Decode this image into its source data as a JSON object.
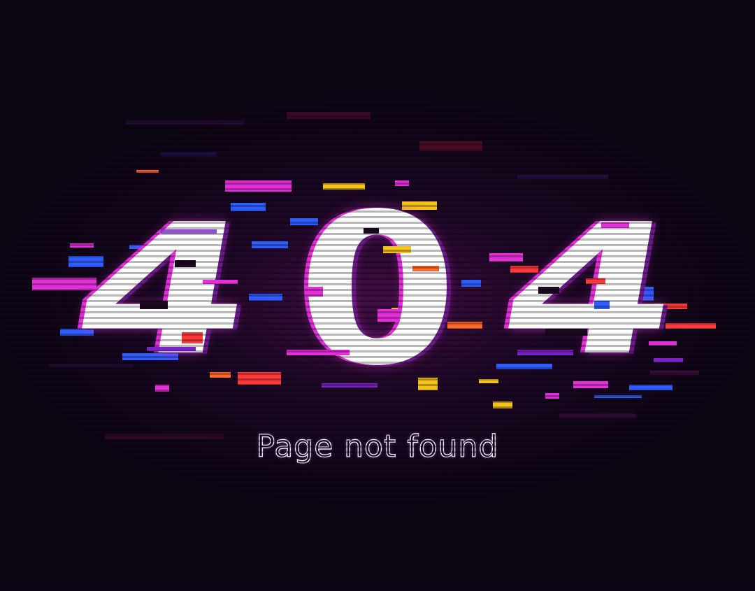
{
  "error": {
    "code_digits": [
      "4",
      "0",
      "4"
    ],
    "message": "Page not found"
  },
  "colors": {
    "background": "#0c0514",
    "glow": "#6e146e",
    "digit_fill": "#ffffff",
    "digit_outline": "#e22fd8",
    "glitch_magenta": "#e22fd8",
    "glitch_blue": "#2f5cff",
    "glitch_yellow": "#f4c21a",
    "glitch_red": "#ff3a3a",
    "glitch_orange": "#ff6a2a",
    "glitch_purple": "#7a22c8",
    "glitch_dark_red": "#6a0f2a"
  }
}
